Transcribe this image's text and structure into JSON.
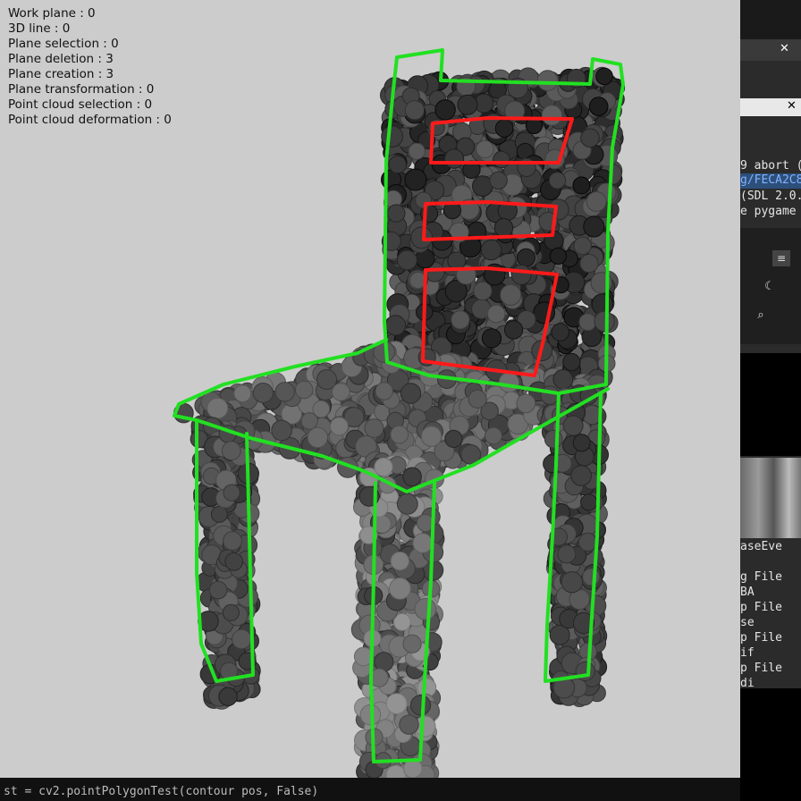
{
  "window": {
    "canvas_background": "#cccccc",
    "stats": [
      {
        "label": "Work plane : 0"
      },
      {
        "label": "3D line : 0"
      },
      {
        "label": "Plane selection : 0"
      },
      {
        "label": "Plane deletion : 3"
      },
      {
        "label": "Plane creation : 3"
      },
      {
        "label": "Plane transformation : 0"
      },
      {
        "label": "Point cloud selection : 0"
      },
      {
        "label": "Point cloud deformation : 0"
      }
    ],
    "sketch_colors": {
      "outline": "#22e022",
      "slats": "#ff1a1a"
    }
  },
  "terminal": {
    "lines": [
      {
        "text": "9 abort (",
        "color": "#e6e6e6"
      },
      {
        "text": "g/FECA2C8",
        "color": "#7fb3ff"
      },
      {
        "text": "(SDL 2.0.",
        "color": "#e6e6e6"
      },
      {
        "text": "e pygame ",
        "color": "#e6e6e6"
      },
      {
        "text": "aseEve",
        "color": "#e6e6e6"
      },
      {
        "text": "g  File",
        "color": "#e6e6e6"
      },
      {
        "text": "    BA",
        "color": "#e6e6e6"
      },
      {
        "text": "p  File",
        "color": "#e6e6e6"
      },
      {
        "text": "    se",
        "color": "#e6e6e6"
      },
      {
        "text": "p  File",
        "color": "#e6e6e6"
      },
      {
        "text": "    if",
        "color": "#e6e6e6"
      },
      {
        "text": "p  File",
        "color": "#e6e6e6"
      },
      {
        "text": "    di",
        "color": "#e6e6e6"
      }
    ]
  },
  "bottom_terminal": {
    "text": "st = cv2.pointPolygonTest(contour     pos, False)"
  }
}
